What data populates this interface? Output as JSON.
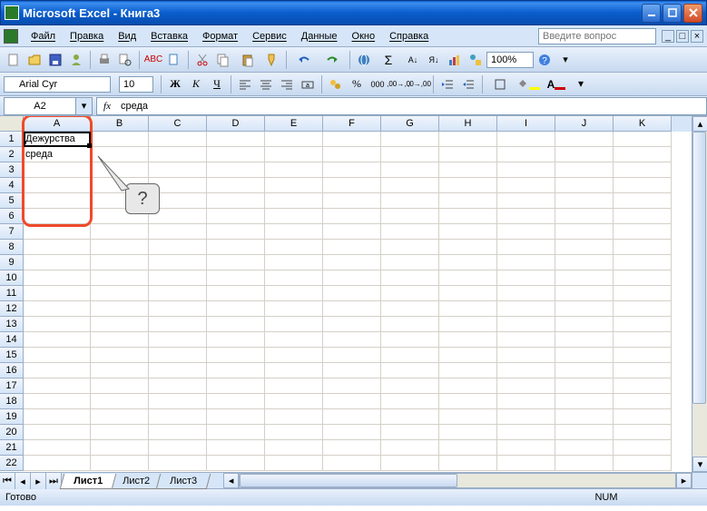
{
  "window": {
    "title": "Microsoft Excel - Книга3"
  },
  "menu": {
    "file": "Файл",
    "edit": "Правка",
    "view": "Вид",
    "insert": "Вставка",
    "format": "Формат",
    "tools": "Сервис",
    "data": "Данные",
    "window": "Окно",
    "help": "Справка"
  },
  "help_placeholder": "Введите вопрос",
  "toolbar": {
    "zoom": "100%"
  },
  "format": {
    "font_name": "Arial Cyr",
    "font_size": "10"
  },
  "namebox": {
    "ref": "A2"
  },
  "formula": {
    "fx": "fx",
    "value": "среда"
  },
  "columns": [
    "A",
    "B",
    "C",
    "D",
    "E",
    "F",
    "G",
    "H",
    "I",
    "J",
    "K"
  ],
  "rows": [
    1,
    2,
    3,
    4,
    5,
    6,
    7,
    8,
    9,
    10,
    11,
    12,
    13,
    14,
    15,
    16,
    17,
    18,
    19,
    20,
    21,
    22
  ],
  "cells": {
    "A1": "Дежурства",
    "A2": "среда"
  },
  "callout": {
    "text": "?"
  },
  "sheets": {
    "s1": "Лист1",
    "s2": "Лист2",
    "s3": "Лист3",
    "active": 0
  },
  "status": {
    "ready": "Готово",
    "num": "NUM"
  }
}
